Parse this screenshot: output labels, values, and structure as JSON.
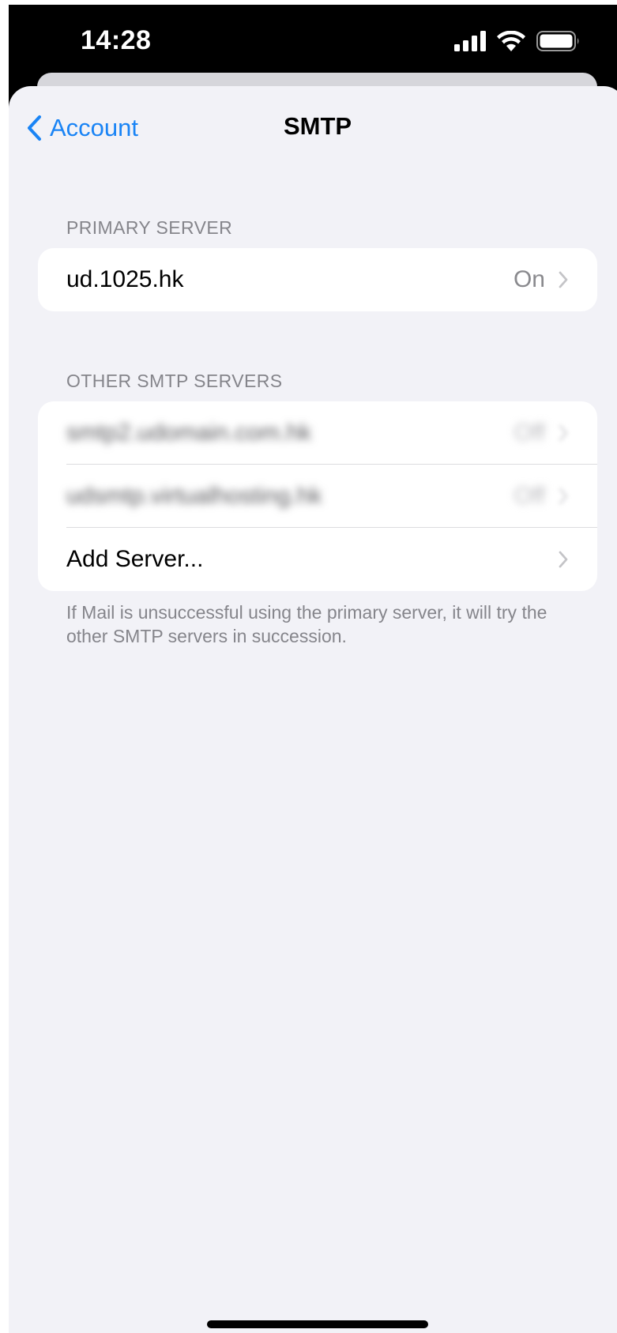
{
  "status_bar": {
    "time": "14:28",
    "icons": [
      "cellular-signal-icon",
      "wifi-icon",
      "battery-icon"
    ]
  },
  "nav": {
    "back_label": "Account",
    "title": "SMTP"
  },
  "primary_section": {
    "header": "PRIMARY SERVER",
    "server": {
      "name": "ud.1025.hk",
      "status": "On"
    }
  },
  "other_section": {
    "header": "OTHER SMTP SERVERS",
    "servers": [
      {
        "name": "smtp2.udomain.com.hk",
        "status": "Off"
      },
      {
        "name": "udsmtp.virtualhosting.hk",
        "status": "Off"
      }
    ],
    "add_label": "Add Server..."
  },
  "footer_note": "If Mail is unsuccessful using the primary server, it will try the other SMTP servers in succession.",
  "colors": {
    "accent": "#1a84f5",
    "background": "#f2f2f7",
    "secondary_text": "#85858b"
  }
}
